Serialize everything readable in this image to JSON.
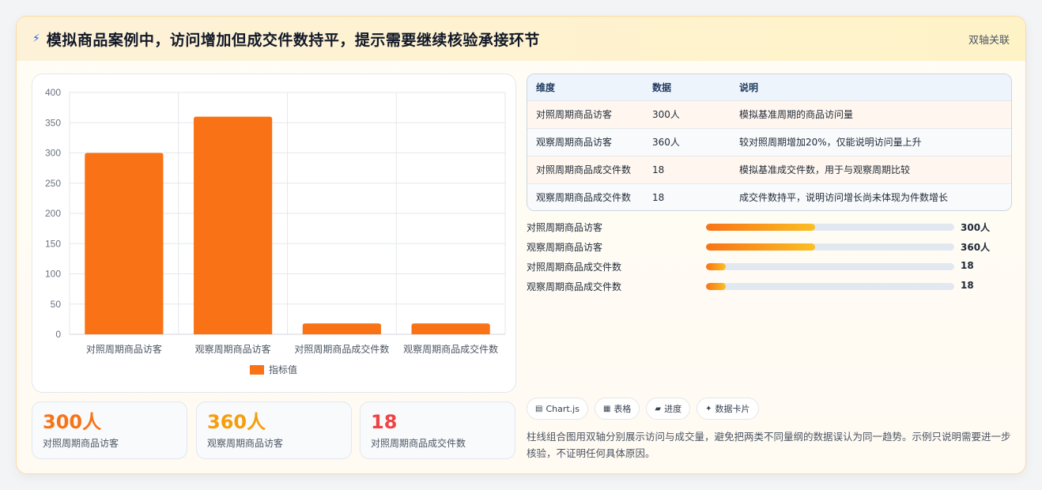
{
  "header": {
    "title": "模拟商品案例中，访问增加但成交件数持平，提示需要继续核验承接环节",
    "tag": "双轴关联"
  },
  "chart_data": {
    "type": "bar",
    "categories": [
      "对照周期商品访客",
      "观察周期商品访客",
      "对照周期商品成交件数",
      "观察周期商品成交件数"
    ],
    "series": [
      {
        "name": "指标值",
        "values": [
          300,
          360,
          18,
          18
        ],
        "color": "#f97316"
      }
    ],
    "ylim": [
      0,
      400
    ],
    "yticks": [
      "0",
      "50",
      "100",
      "150",
      "200",
      "250",
      "300",
      "350",
      "400"
    ],
    "grid": true,
    "legend": "bottom"
  },
  "stats": [
    {
      "value": "300人",
      "label": "对照周期商品访客",
      "color": "#f97316"
    },
    {
      "value": "360人",
      "label": "观察周期商品访客",
      "color": "#f59e0b"
    },
    {
      "value": "18",
      "label": "对照周期商品成交件数",
      "color": "#ef4444"
    }
  ],
  "table": {
    "headers": [
      "维度",
      "数据",
      "说明"
    ],
    "rows": [
      [
        "对照周期商品访客",
        "300人",
        "模拟基准周期的商品访问量"
      ],
      [
        "观察周期商品访客",
        "360人",
        "较对照周期增加20%，仅能说明访问量上升"
      ],
      [
        "对照周期商品成交件数",
        "18",
        "模拟基准成交件数，用于与观察周期比较"
      ],
      [
        "观察周期商品成交件数",
        "18",
        "成交件数持平，说明访问增长尚未体现为件数增长"
      ]
    ]
  },
  "progress": [
    {
      "label": "对照周期商品访客",
      "value": "300人",
      "fraction": 0.44
    },
    {
      "label": "观察周期商品访客",
      "value": "360人",
      "fraction": 0.44
    },
    {
      "label": "对照周期商品成交件数",
      "value": "18",
      "fraction": 0.08
    },
    {
      "label": "观察周期商品成交件数",
      "value": "18",
      "fraction": 0.08
    }
  ],
  "chips": [
    {
      "icon": "chart-icon",
      "glyph": "▤",
      "label": "Chart.js"
    },
    {
      "icon": "table-icon",
      "glyph": "▦",
      "label": "表格"
    },
    {
      "icon": "progress-icon",
      "glyph": "▰",
      "label": "进度"
    },
    {
      "icon": "sparkle-icon",
      "glyph": "✦",
      "label": "数据卡片"
    }
  ],
  "note": "柱线组合图用双轴分别展示访问与成交量，避免把两类不同量纲的数据误认为同一趋势。示例只说明需要进一步核验，不证明任何具体原因。"
}
